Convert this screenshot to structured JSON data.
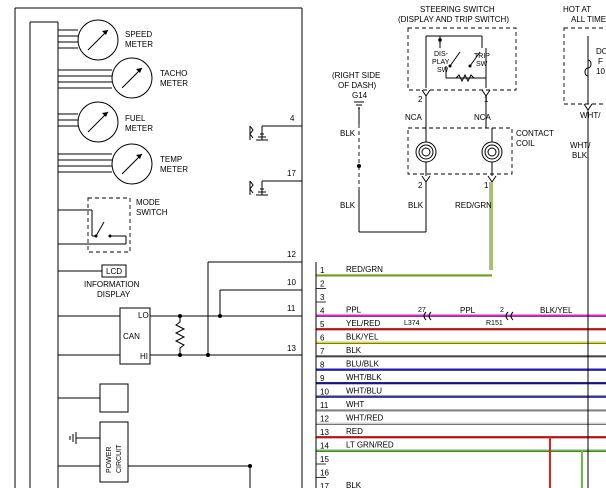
{
  "gauges": {
    "speed": [
      "SPEED",
      "METER"
    ],
    "tacho": [
      "TACHO",
      "METER"
    ],
    "fuel": [
      "FUEL",
      "METER"
    ],
    "temp": [
      "TEMP",
      "METER"
    ]
  },
  "mode_switch": [
    "MODE",
    "SWITCH"
  ],
  "lcd": "LCD",
  "info_display": [
    "INFORMATION",
    "DISPLAY"
  ],
  "can": {
    "label": "CAN",
    "lo": "LO",
    "hi": "HI"
  },
  "power_circuit": [
    "POWER",
    "CIRCUIT"
  ],
  "cluster_pins": {
    "p4": "4",
    "p17": "17",
    "p12": "12",
    "p10": "10",
    "p11": "11",
    "p13": "13"
  },
  "steering_switch": {
    "title": [
      "STEERING SWITCH",
      "(DISPLAY AND TRIP SWITCH)"
    ],
    "display_sw": [
      "DIS-",
      "PLAY",
      "SW"
    ],
    "trip_sw": [
      "TRIP",
      "SW"
    ],
    "pin_left": "2",
    "pin_right": "1",
    "nca_left": "NCA",
    "nca_right": "NCA"
  },
  "contact_coil": {
    "label": [
      "CONTACT",
      "COIL"
    ],
    "pin_left": "2",
    "pin_right": "1"
  },
  "ground": {
    "label": [
      "(RIGHT SIDE",
      "OF DASH)"
    ],
    "id": "G14"
  },
  "hot_at": [
    "HOT AT",
    "ALL TIME"
  ],
  "fuse_box": [
    "DO",
    "F",
    "10"
  ],
  "wire_labels": {
    "gnd_blk_top": "BLK",
    "gnd_blk_bottom": "BLK",
    "coil_blk": "BLK",
    "coil_red_grn": "RED/GRN",
    "hot_wire_top": "WHT/",
    "hot_wire_bottom": "BLK"
  },
  "connectors": {
    "c27": "27",
    "l374": "L374",
    "c2": "2",
    "r151": "R151",
    "ppl_mid": "PPL",
    "blk_yel_right": "BLK/YEL"
  },
  "connector_rows": [
    {
      "pin": "1",
      "wire": "RED/GRN",
      "color": "#9ccc3c"
    },
    {
      "pin": "2",
      "wire": "",
      "color": ""
    },
    {
      "pin": "3",
      "wire": "",
      "color": ""
    },
    {
      "pin": "4",
      "wire": "PPL",
      "color": "#e020d8"
    },
    {
      "pin": "5",
      "wire": "YEL/RED",
      "color": "#e02020"
    },
    {
      "pin": "6",
      "wire": "BLK/YEL",
      "color": "#d8d820"
    },
    {
      "pin": "7",
      "wire": "BLK",
      "color": "#000000"
    },
    {
      "pin": "8",
      "wire": "BLU/BLK",
      "color": "#2020c0"
    },
    {
      "pin": "9",
      "wire": "WHT/BLK",
      "color": "#2020a0"
    },
    {
      "pin": "10",
      "wire": "WHT/BLU",
      "color": "#3030c0"
    },
    {
      "pin": "11",
      "wire": "WHT",
      "color": "#b0b0b0"
    },
    {
      "pin": "12",
      "wire": "WHT/RED",
      "color": "#d0d0d0"
    },
    {
      "pin": "13",
      "wire": "RED",
      "color": "#e02020"
    },
    {
      "pin": "14",
      "wire": "LT GRN/RED",
      "color": "#60c040"
    },
    {
      "pin": "15",
      "wire": "",
      "color": ""
    },
    {
      "pin": "16",
      "wire": "",
      "color": ""
    },
    {
      "pin": "17",
      "wire": "BLK",
      "color": "#000000"
    }
  ]
}
